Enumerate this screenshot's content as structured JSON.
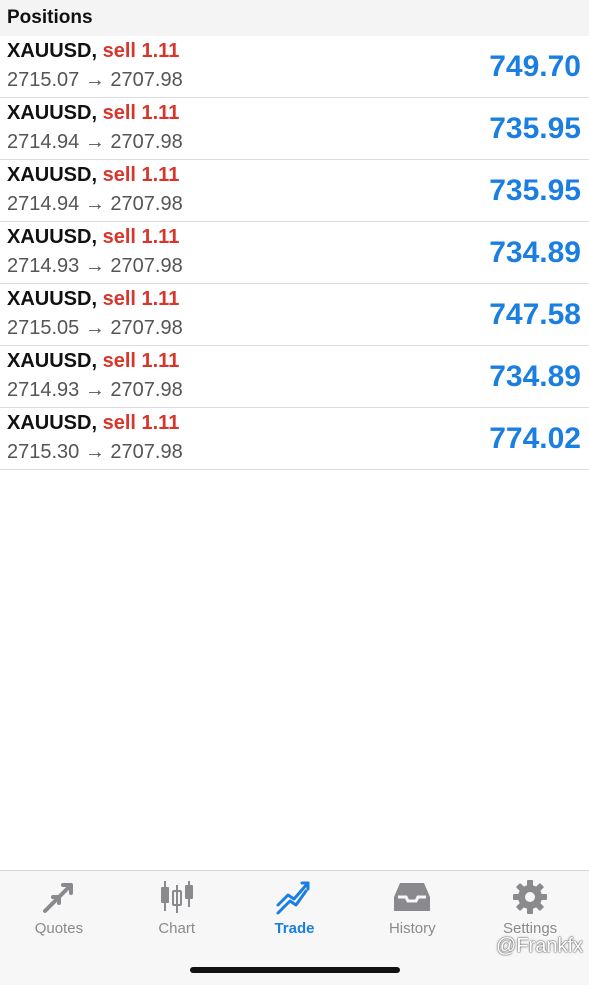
{
  "header": {
    "title": "Positions"
  },
  "positions": [
    {
      "symbol": "XAUUSD,",
      "side": "sell 1.11",
      "open": "2715.07",
      "arrow": "→",
      "current": "2707.98",
      "profit": "749.70"
    },
    {
      "symbol": "XAUUSD,",
      "side": "sell 1.11",
      "open": "2714.94",
      "arrow": "→",
      "current": "2707.98",
      "profit": "735.95"
    },
    {
      "symbol": "XAUUSD,",
      "side": "sell 1.11",
      "open": "2714.94",
      "arrow": "→",
      "current": "2707.98",
      "profit": "735.95"
    },
    {
      "symbol": "XAUUSD,",
      "side": "sell 1.11",
      "open": "2714.93",
      "arrow": "→",
      "current": "2707.98",
      "profit": "734.89"
    },
    {
      "symbol": "XAUUSD,",
      "side": "sell 1.11",
      "open": "2715.05",
      "arrow": "→",
      "current": "2707.98",
      "profit": "747.58"
    },
    {
      "symbol": "XAUUSD,",
      "side": "sell 1.11",
      "open": "2714.93",
      "arrow": "→",
      "current": "2707.98",
      "profit": "734.89"
    },
    {
      "symbol": "XAUUSD,",
      "side": "sell 1.11",
      "open": "2715.30",
      "arrow": "→",
      "current": "2707.98",
      "profit": "774.02"
    }
  ],
  "tabbar": {
    "tabs": [
      {
        "label": "Quotes",
        "icon": "quotes-arrows-icon",
        "active": false
      },
      {
        "label": "Chart",
        "icon": "candlestick-icon",
        "active": false
      },
      {
        "label": "Trade",
        "icon": "trade-trend-icon",
        "active": true
      },
      {
        "label": "History",
        "icon": "inbox-tray-icon",
        "active": false
      },
      {
        "label": "Settings",
        "icon": "gear-icon",
        "active": false
      }
    ]
  },
  "watermark": {
    "text": "@Frankfx"
  },
  "colors": {
    "sell": "#d8362b",
    "profit": "#1a7fe0",
    "active_tab": "#1a7fe0",
    "inactive_tab": "#8a8a8e"
  }
}
